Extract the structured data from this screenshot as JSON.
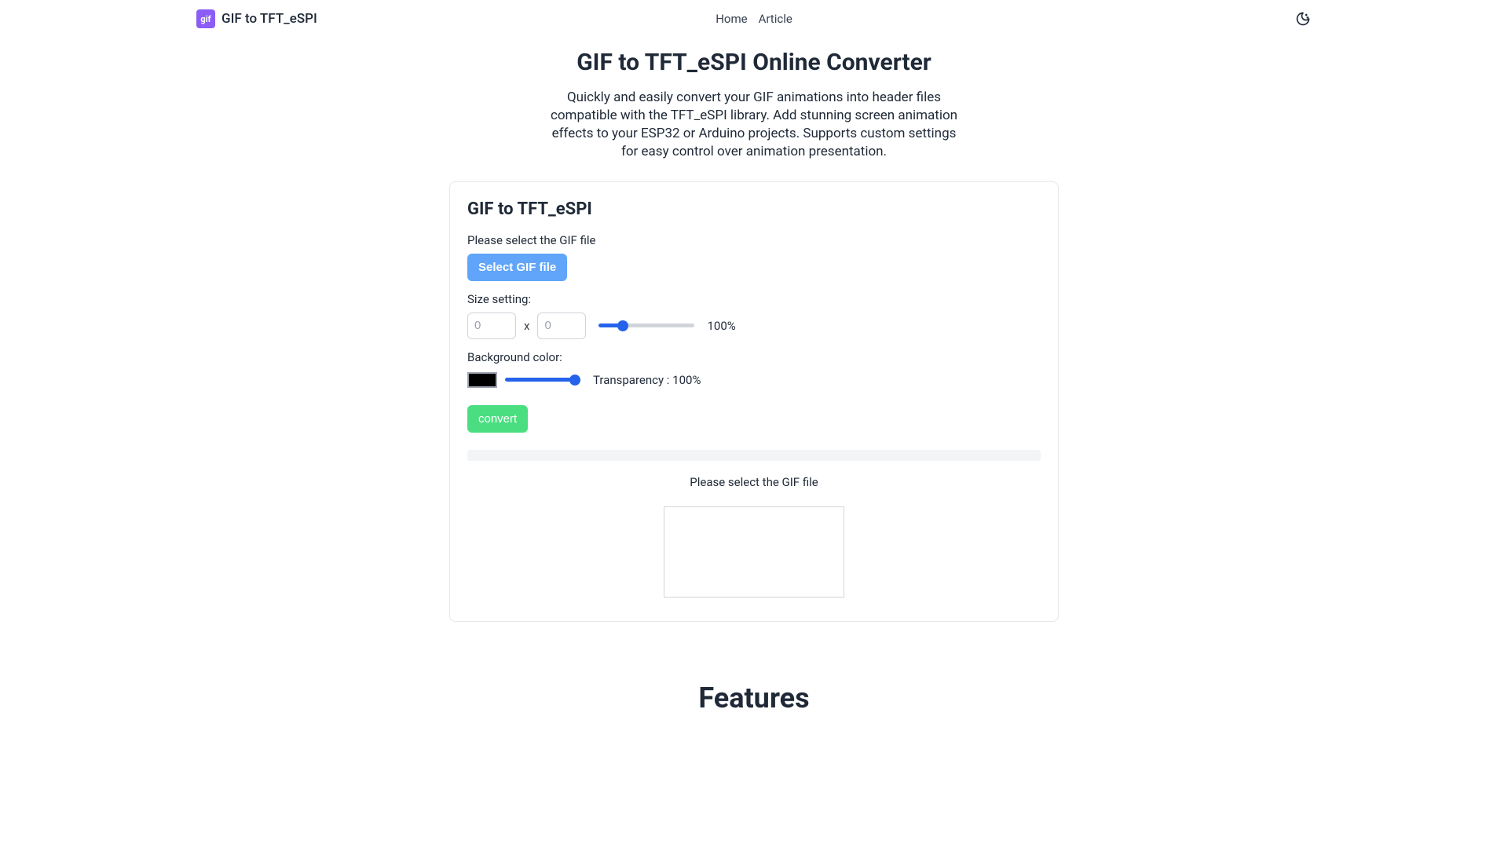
{
  "header": {
    "brand_logo_text": "gif",
    "brand_text": "GIF to TFT_eSPI",
    "nav": {
      "home": "Home",
      "article": "Article"
    }
  },
  "page": {
    "title": "GIF to TFT_eSPI Online Converter",
    "description": "Quickly and easily convert your GIF animations into header files compatible with the TFT_eSPI library. Add stunning screen animation effects to your ESP32 or Arduino projects. Supports custom settings for easy control over animation presentation."
  },
  "card": {
    "title": "GIF to TFT_eSPI",
    "select_label": "Please select the GIF file",
    "select_button": "Select GIF file",
    "size_label": "Size setting:",
    "width_placeholder": "0",
    "height_placeholder": "0",
    "x_separator": "x",
    "size_percent": "100%",
    "bg_label": "Background color:",
    "bg_color": "#000000",
    "transparency_label": "Transparency : 100%",
    "convert_button": "convert",
    "status_text": "Please select the GIF file"
  },
  "features": {
    "heading": "Features"
  }
}
